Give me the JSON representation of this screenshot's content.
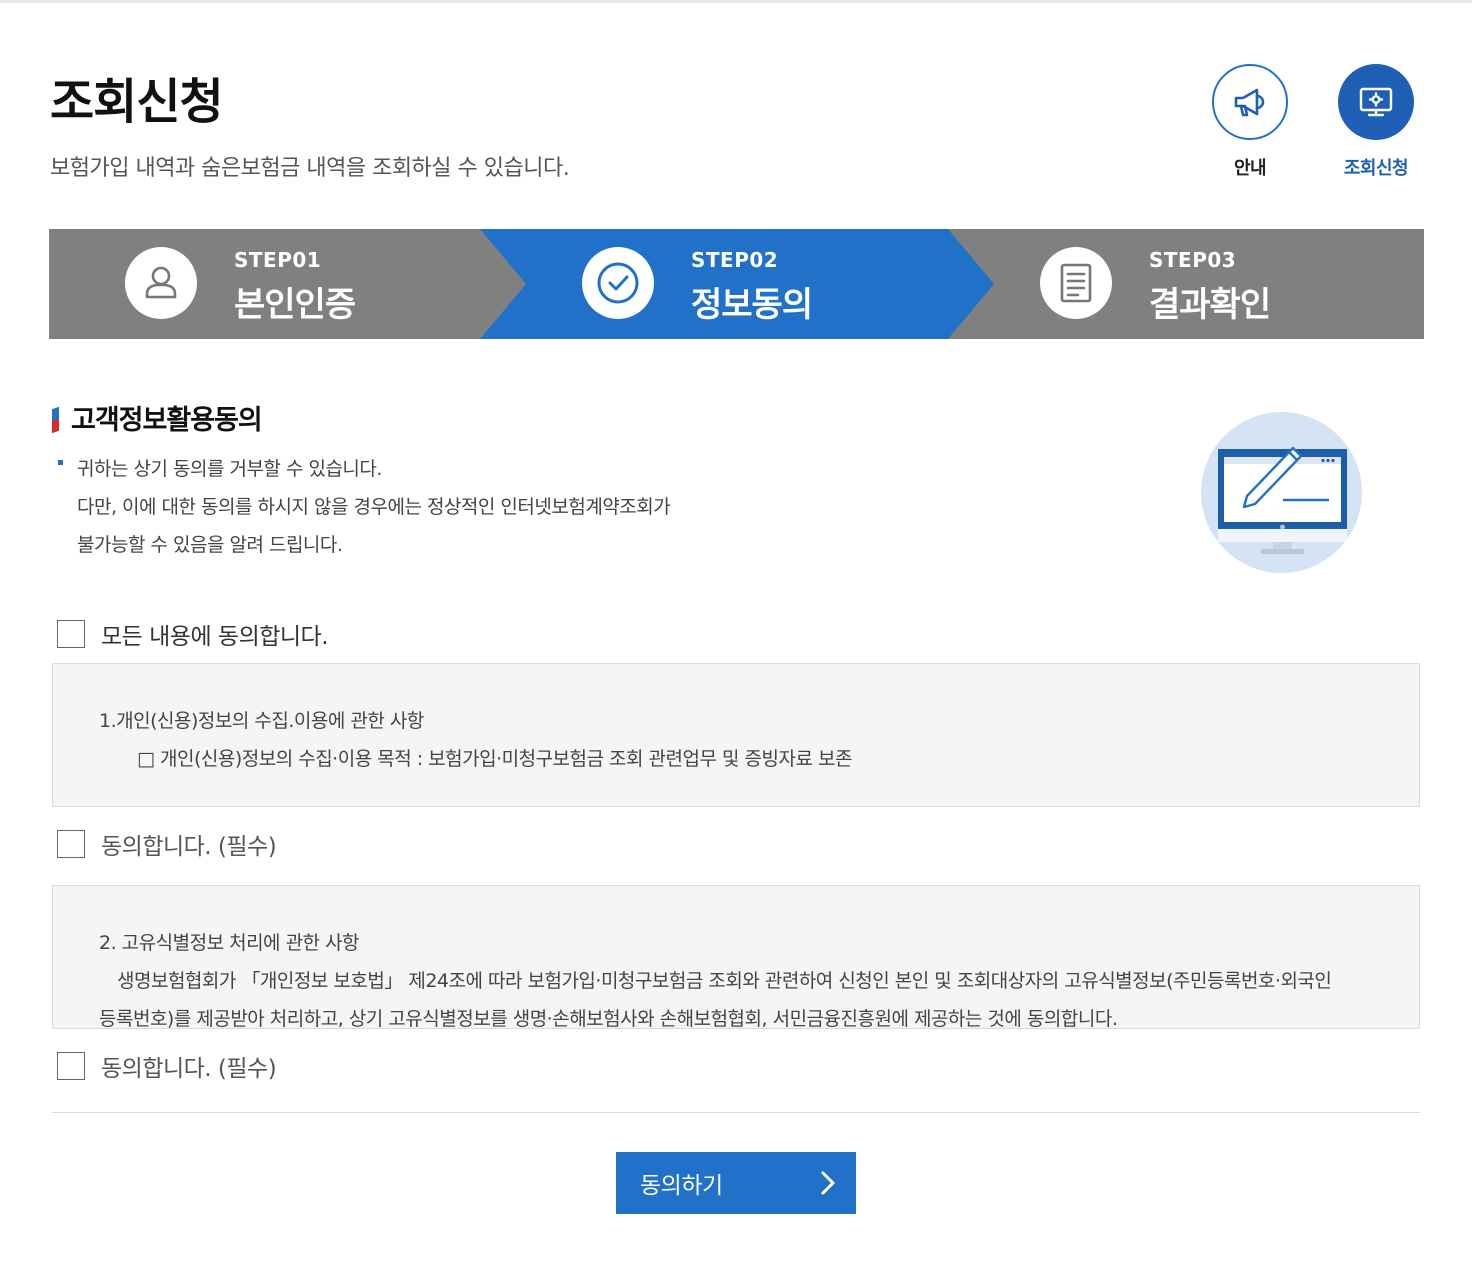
{
  "header": {
    "title": "조회신청",
    "subtitle": "보험가입 내역과 숨은보험금 내역을 조회하실 수 있습니다."
  },
  "topnav": [
    {
      "label": "안내",
      "icon": "megaphone-icon"
    },
    {
      "label": "조회신청",
      "icon": "monitor-settings-icon",
      "active": true
    }
  ],
  "steps": [
    {
      "num": "STEP01",
      "name": "본인인증",
      "icon": "person-icon"
    },
    {
      "num": "STEP02",
      "name": "정보동의",
      "icon": "check-circle-icon",
      "active": true
    },
    {
      "num": "STEP03",
      "name": "결과확인",
      "icon": "document-icon"
    }
  ],
  "section": {
    "title": "고객정보활용동의",
    "notice": [
      "귀하는 상기 동의를 거부할 수 있습니다.",
      "다만, 이에 대한 동의를 하시지 않을 경우에는 정상적인 인터넷보험계약조회가",
      "불가능할 수 있음을 알려 드립니다."
    ]
  },
  "agree_all": "모든 내용에 동의합니다.",
  "terms": [
    {
      "title": "1.개인(신용)정보의 수집.이용에 관한 사항",
      "body": [
        "□ 개인(신용)정보의 수집·이용 목적 : 보험가입·미청구보험금 조회 관련업무 및 증빙자료 보존"
      ],
      "agree_label": "동의합니다. (필수)"
    },
    {
      "title": "2. 고유식별정보 처리에 관한 사항",
      "body": [
        "생명보험협회가 「개인정보 보호법」 제24조에 따라 보험가입·미청구보험금 조회와 관련하여 신청인 본인 및 조회대상자의 고유식별정보(주민등록번호·외국인",
        "등록번호)를 제공받아 처리하고, 상기 고유식별정보를 생명·손해보험사와 손해보험협회, 서민금융진흥원에 제공하는 것에 동의합니다."
      ],
      "agree_label": "동의합니다. (필수)"
    }
  ],
  "submit_label": "동의하기",
  "colors": {
    "accent": "#2271c9",
    "step_inactive": "#808080",
    "nav_active": "#1f5fb5"
  }
}
